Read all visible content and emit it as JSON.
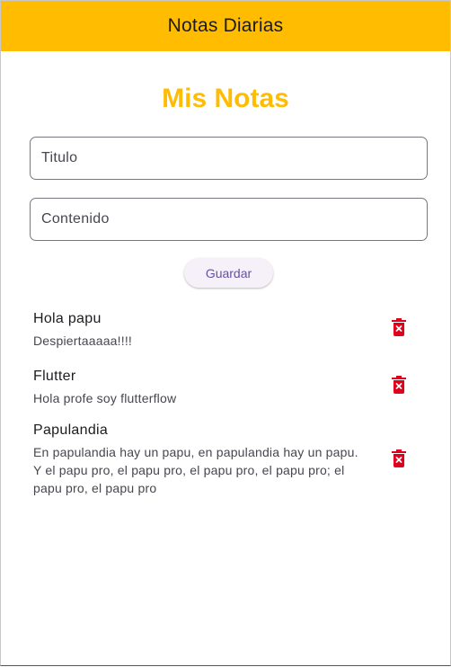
{
  "appbar": {
    "title": "Notas Diarias"
  },
  "page": {
    "heading": "Mis Notas"
  },
  "form": {
    "title_placeholder": "Titulo",
    "title_value": "",
    "content_placeholder": "Contenido",
    "content_value": "",
    "save_label": "Guardar"
  },
  "notes": [
    {
      "title": "Hola papu",
      "body": "Despiertaaaaa!!!!"
    },
    {
      "title": "Flutter",
      "body": "Hola profe soy flutterflow"
    },
    {
      "title": "Papulandia",
      "body": "En papulandia hay un papu, en papulandia hay un papu. Y el papu pro, el papu pro, el papu pro, el papu pro; el papu pro, el papu pro"
    }
  ],
  "icons": {
    "delete": "delete-forever-icon"
  },
  "colors": {
    "primary": "#FFBC00",
    "delete": "#E0001B",
    "button_text": "#6750A4"
  }
}
